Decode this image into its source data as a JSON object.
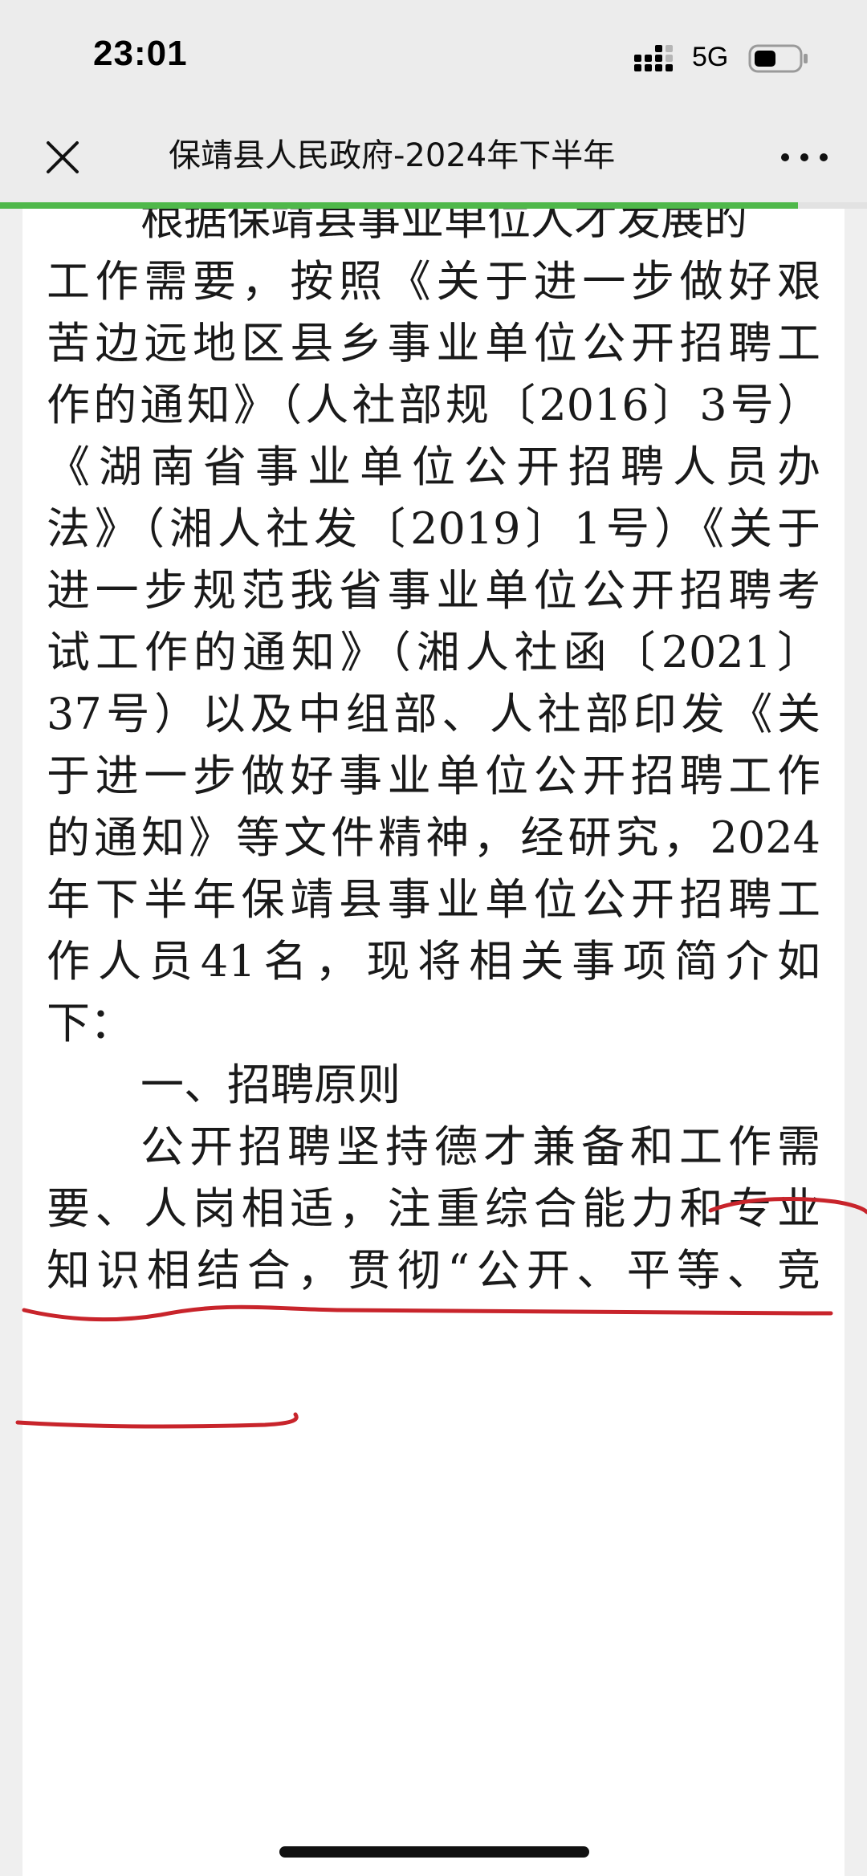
{
  "status_bar": {
    "time": "23:01",
    "network": "5G",
    "icons": [
      "signal-icon",
      "battery-icon"
    ]
  },
  "nav": {
    "title": "保靖县人民政府-2024年下半年",
    "close_icon": "close-icon",
    "more_icon": "more-icon"
  },
  "progress": {
    "fraction": 0.92,
    "color": "#4fb84a"
  },
  "article": {
    "lines": [
      "根据保靖县事业单位人才发展的",
      "工作需要，按照《关于进一步做好艰",
      "苦边远地区县乡事业单位公开招聘工",
      "作的通知》（人社部规〔2016〕3号）",
      "《湖南省事业单位公开招聘人员办",
      "法》（湘人社发〔2019〕1号）《关于",
      "进一步规范我省事业单位公开招聘考",
      "试工作的通知》（湘人社函〔2021〕",
      "37号）以及中组部、人社部印发《关",
      "于进一步做好事业单位公开招聘工作",
      "的通知》等文件精神，经研究，2024",
      "年下半年保靖县事业单位公开招聘工",
      "作人员41名，现将相关事项简介如",
      "下：",
      "一、招聘原则",
      "公开招聘坚持德才兼备和工作需",
      "要、人岗相适，注重综合能力和专业",
      "知识相结合，贯彻“公开、平等、竞"
    ]
  },
  "colors": {
    "annotation": "#c8242b",
    "text": "#1a1a1a",
    "background": "#ffffff"
  }
}
